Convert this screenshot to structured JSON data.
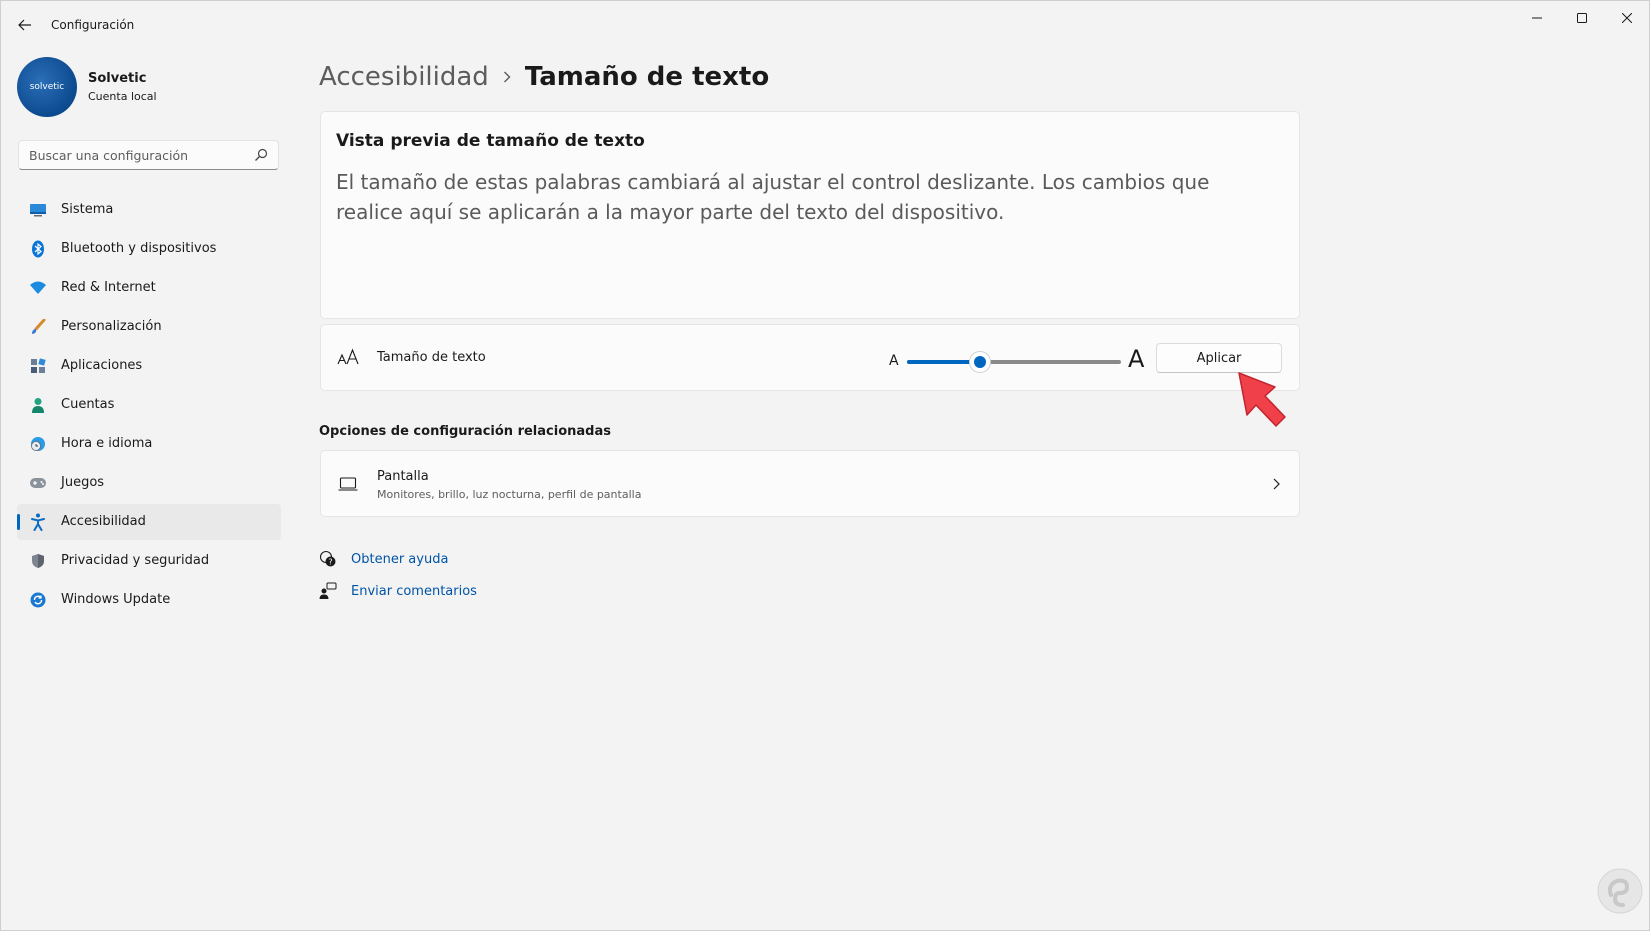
{
  "window": {
    "title": "Configuración"
  },
  "profile": {
    "name": "Solvetic",
    "account_type": "Cuenta local",
    "avatar_text": "solvetic"
  },
  "search": {
    "placeholder": "Buscar una configuración"
  },
  "sidebar": {
    "items": [
      {
        "label": "Sistema",
        "icon": "monitor-icon",
        "active": false
      },
      {
        "label": "Bluetooth y dispositivos",
        "icon": "bluetooth-icon",
        "active": false
      },
      {
        "label": "Red & Internet",
        "icon": "wifi-icon",
        "active": false
      },
      {
        "label": "Personalización",
        "icon": "brush-icon",
        "active": false
      },
      {
        "label": "Aplicaciones",
        "icon": "apps-icon",
        "active": false
      },
      {
        "label": "Cuentas",
        "icon": "person-icon",
        "active": false
      },
      {
        "label": "Hora e idioma",
        "icon": "globe-clock-icon",
        "active": false
      },
      {
        "label": "Juegos",
        "icon": "gamepad-icon",
        "active": false
      },
      {
        "label": "Accesibilidad",
        "icon": "accessibility-icon",
        "active": true
      },
      {
        "label": "Privacidad y seguridad",
        "icon": "shield-icon",
        "active": false
      },
      {
        "label": "Windows Update",
        "icon": "update-icon",
        "active": false
      }
    ]
  },
  "breadcrumb": {
    "parent": "Accesibilidad",
    "current": "Tamaño de texto"
  },
  "preview": {
    "title": "Vista previa de tamaño de texto",
    "text": "El tamaño de estas palabras cambiará al ajustar el control deslizante. Los cambios que realice aquí se aplicarán a la mayor parte del texto del dispositivo."
  },
  "text_size": {
    "label": "Tamaño de texto",
    "small_glyph": "A",
    "large_glyph": "A",
    "slider_value": 0.34,
    "apply_label": "Aplicar"
  },
  "related": {
    "heading": "Opciones de configuración relacionadas",
    "display_title": "Pantalla",
    "display_subtitle": "Monitores, brillo, luz nocturna, perfil de pantalla"
  },
  "help": {
    "get_help": "Obtener ayuda",
    "feedback": "Enviar comentarios"
  },
  "colors": {
    "accent": "#0067c0",
    "link": "#0054a6",
    "pointer": "#f0404a"
  }
}
